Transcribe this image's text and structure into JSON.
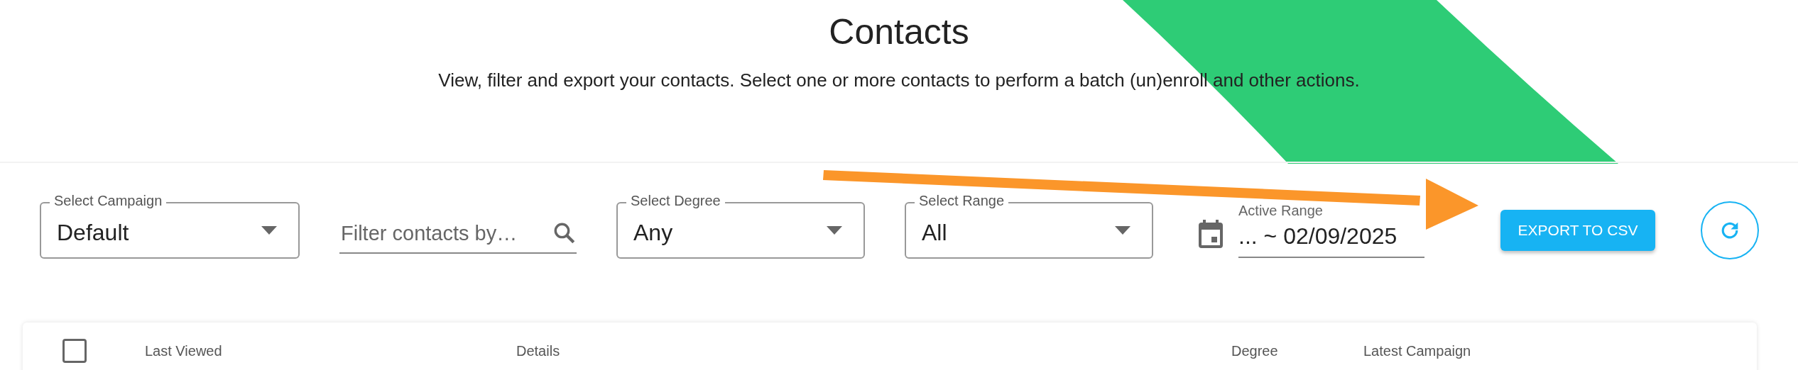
{
  "header": {
    "title": "Contacts",
    "subtitle": "View, filter and export your contacts. Select one or more contacts to perform a batch (un)enroll and other actions."
  },
  "filters": [
    {
      "kind": "select",
      "label": "Select Campaign",
      "value": "Default"
    },
    {
      "kind": "search",
      "placeholder": "Filter contacts by…"
    },
    {
      "kind": "select",
      "label": "Select Degree",
      "value": "Any"
    },
    {
      "kind": "select",
      "label": "Select Range",
      "value": "All"
    },
    {
      "kind": "date",
      "label": "Active Range",
      "value": "... ~ 02/09/2025"
    }
  ],
  "export_button": "EXPORT TO CSV",
  "table": {
    "select_all": {
      "checked": false
    },
    "columns": [
      "Last Viewed",
      "Details",
      "Degree",
      "Latest Campaign"
    ]
  }
}
